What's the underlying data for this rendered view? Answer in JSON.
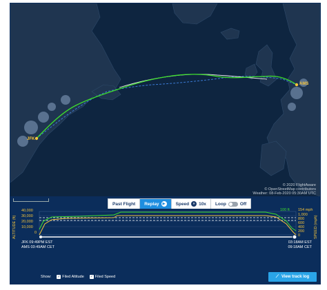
{
  "map": {
    "origin_code": "JFK",
    "destination_code": "AMS",
    "attribution_copyright": "© 2020 FlightAware",
    "attribution_osm": "© OpenStreetMap contributors",
    "weather_note": "Weather: 08-Feb-2020 05:30AM UTC",
    "colors": {
      "ocean": "#0e2540",
      "land": "#1f3550",
      "actual_track": "#3ee02c",
      "planned_track": "#ffffff",
      "filed_route": "#3b7bd6",
      "airport": "#f6c43a"
    }
  },
  "controls": {
    "past_flight_label": "Past Flight",
    "replay_label": "Replay",
    "speed_label": "Speed",
    "speed_value": "10x",
    "loop_label": "Loop",
    "loop_state": "Off"
  },
  "profile": {
    "altitude_axis_label": "ALTITUDE (ft)",
    "speed_axis_label": "SPEED (mph)",
    "altitude_ticks": [
      "40,000",
      "30,000",
      "20,000",
      "10,000",
      "0"
    ],
    "speed_ticks": [
      "1,000",
      "800",
      "600",
      "400",
      "200",
      "0"
    ],
    "current_altitude": "100 ft",
    "current_speed": "154 mph",
    "departure_time_local": "JFK 09:49PM EST",
    "departure_time_dest": "AMS 03:49AM CET",
    "arrival_time_origin": "03:18AM EST",
    "arrival_time_dest": "09:18AM CET",
    "show_label": "Show:",
    "filed_altitude_label": "Filed Altitude",
    "filed_speed_label": "Filed Speed",
    "view_track_log_label": "View track log",
    "colors": {
      "altitude": "#f6c43a",
      "speed": "#3ee02c",
      "filed": "#ffffff"
    }
  }
}
